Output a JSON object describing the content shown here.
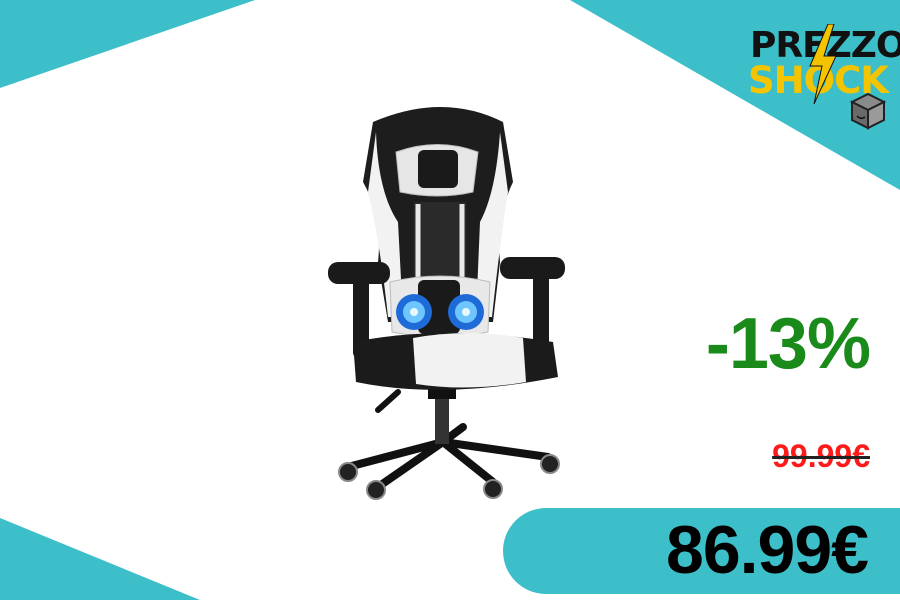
{
  "brand": {
    "logo_line1": "PREZZO",
    "logo_line2": "SHOCK",
    "accent_color": "#3cbfc9",
    "logo_yellow": "#f5c400"
  },
  "product": {
    "image_icon": "gaming-chair-icon"
  },
  "pricing": {
    "discount": "-13%",
    "old_price": "99.99€",
    "new_price": "86.99€",
    "discount_color": "#1a8a1a",
    "old_price_color": "#ff1a1a"
  }
}
